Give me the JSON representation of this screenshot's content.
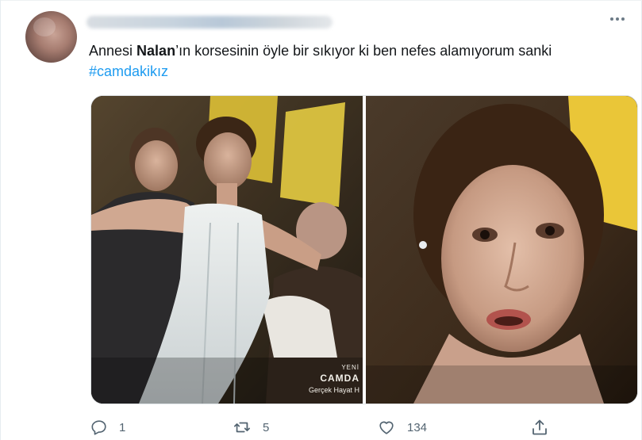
{
  "tweet": {
    "text_before": "Annesi ",
    "text_bold": "Nalan",
    "text_after": "’ın korsesinin öyle bir sıkıyor ki ben nefes alamıyorum sanki",
    "hashtag": "#camdakikız"
  },
  "media": {
    "watermark": {
      "line1": "YENİ",
      "line2": "CAMDA",
      "line3": "Gerçek Hayat H"
    }
  },
  "actions": {
    "reply_count": "1",
    "retweet_count": "5",
    "like_count": "134"
  },
  "colors": {
    "hashtag": "#1d9bf0",
    "icon": "#536471",
    "text": "#14171a"
  },
  "icons": [
    "more-icon",
    "reply-icon",
    "retweet-icon",
    "like-icon",
    "share-icon"
  ]
}
